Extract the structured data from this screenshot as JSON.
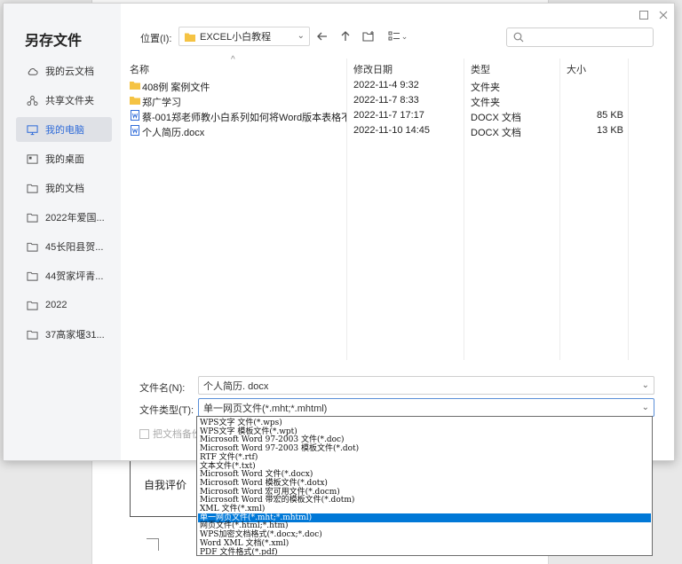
{
  "background": {
    "table_label": "自我评价"
  },
  "dialog": {
    "title": "另存文件",
    "sidebar": [
      {
        "label": "我的云文档",
        "icon": "cloud-icon"
      },
      {
        "label": "共享文件夹",
        "icon": "share-icon"
      },
      {
        "label": "我的电脑",
        "icon": "computer-icon",
        "active": true
      },
      {
        "label": "我的桌面",
        "icon": "desktop-icon"
      },
      {
        "label": "我的文档",
        "icon": "documents-icon"
      },
      {
        "label": "2022年爱国...",
        "icon": "folder-icon"
      },
      {
        "label": "45长阳县贺...",
        "icon": "folder-icon"
      },
      {
        "label": "44贺家坪青...",
        "icon": "folder-icon"
      },
      {
        "label": "2022",
        "icon": "folder-icon"
      },
      {
        "label": "37高家堰31...",
        "icon": "folder-icon"
      }
    ],
    "location_label": "位置(I):",
    "location_value": "EXCEL小白教程",
    "columns": {
      "name": "名称",
      "date": "修改日期",
      "type": "类型",
      "size": "大小"
    },
    "files": [
      {
        "name": "408例 案例文件",
        "date": "2022-11-4 9:32",
        "type": "文件夹",
        "size": "",
        "kind": "folder"
      },
      {
        "name": "郑广学习",
        "date": "2022-11-7 8:33",
        "type": "文件夹",
        "size": "",
        "kind": "folder"
      },
      {
        "name": "蔡-001郑老师教小白系列如何将Word版本表格不...",
        "date": "2022-11-7 17:17",
        "type": "DOCX 文档",
        "size": "85 KB",
        "kind": "docx"
      },
      {
        "name": "个人简历.docx",
        "date": "2022-11-10 14:45",
        "type": "DOCX 文档",
        "size": "13 KB",
        "kind": "docx"
      }
    ],
    "filename_label": "文件名(N):",
    "filename_value": "个人简历. docx",
    "filetype_label": "文件类型(T):",
    "filetype_value": "单一网页文件(*.mht;*.mhtml)",
    "backup_label": "把文档备份",
    "filetype_options": [
      "WPS文字 文件(*.wps)",
      "WPS文字 模板文件(*.wpt)",
      "Microsoft Word 97-2003 文件(*.doc)",
      "Microsoft Word 97-2003 模板文件(*.dot)",
      "RTF 文件(*.rtf)",
      "文本文件(*.txt)",
      "Microsoft Word 文件(*.docx)",
      "Microsoft Word 模板文件(*.dotx)",
      "Microsoft Word 宏可用文件(*.docm)",
      "Microsoft Word 带宏的模板文件(*.dotm)",
      "XML 文件(*.xml)",
      "单一网页文件(*.mht;*.mhtml)",
      "网页文件(*.html;*.htm)",
      "WPS加密文档格式(*.docx;*.doc)",
      "Word XML 文档(*.xml)",
      "PDF 文件格式(*.pdf)"
    ],
    "selected_option_index": 11
  }
}
